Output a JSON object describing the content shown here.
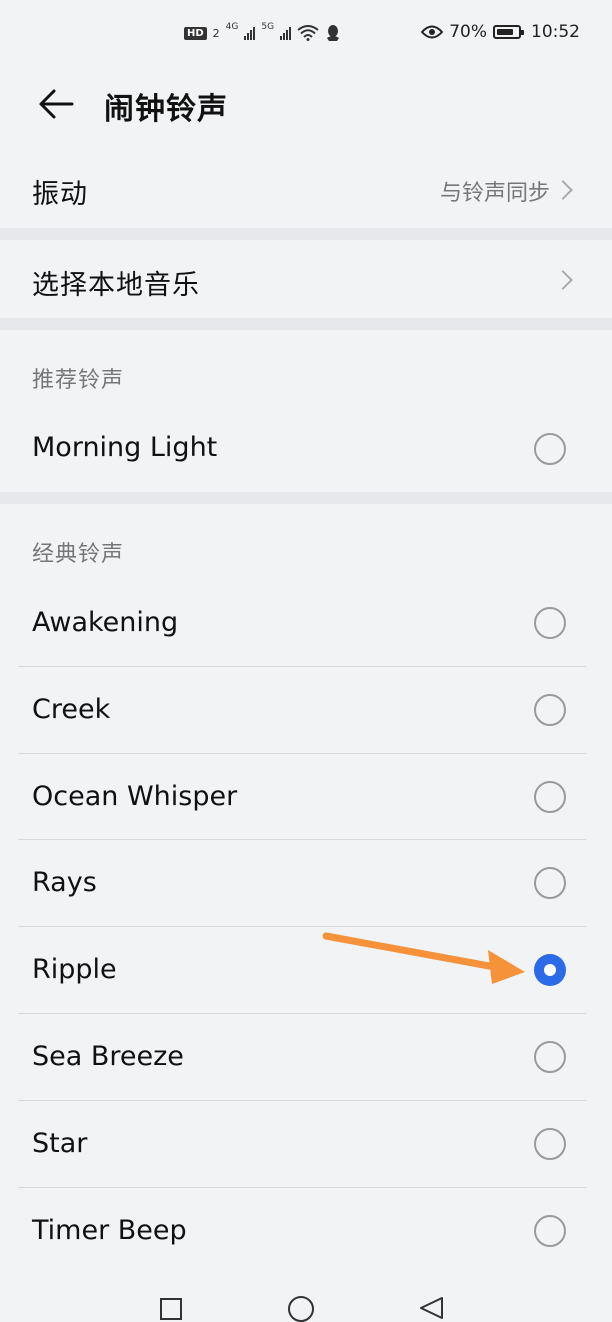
{
  "status_bar": {
    "hd_badge": "HD",
    "sim_2": "2",
    "net_4g": "4G",
    "net_5g": "5G",
    "battery_percent": "70%",
    "time": "10:52",
    "icons": [
      "hd-icon",
      "signal-4g-icon",
      "signal-5g-icon",
      "wifi-icon",
      "qq-notification-icon",
      "eye-comfort-icon",
      "battery-icon"
    ]
  },
  "header": {
    "title": "闹钟铃声",
    "back_icon": "back-arrow-icon"
  },
  "settings": {
    "vibration_label": "振动",
    "vibration_value": "与铃声同步",
    "local_music_label": "选择本地音乐"
  },
  "recommended": {
    "title": "推荐铃声",
    "items": [
      {
        "label": "Morning Light",
        "selected": false
      }
    ]
  },
  "classic": {
    "title": "经典铃声",
    "items": [
      {
        "label": "Awakening",
        "selected": false
      },
      {
        "label": "Creek",
        "selected": false
      },
      {
        "label": "Ocean Whisper",
        "selected": false
      },
      {
        "label": "Rays",
        "selected": false
      },
      {
        "label": "Ripple",
        "selected": true
      },
      {
        "label": "Sea Breeze",
        "selected": false
      },
      {
        "label": "Star",
        "selected": false
      },
      {
        "label": "Timer Beep",
        "selected": false
      }
    ]
  },
  "colors": {
    "accent": "#2c6be8",
    "annotation_arrow": "#f5923a",
    "background": "#f1f3f5"
  },
  "nav_bar": {
    "icons": [
      "recents-square-icon",
      "home-circle-icon",
      "back-triangle-icon"
    ]
  }
}
